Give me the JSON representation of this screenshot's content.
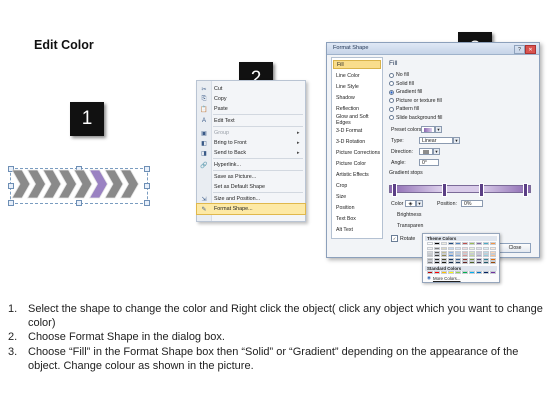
{
  "page": {
    "title": "Edit Color"
  },
  "steps": [
    "1",
    "2",
    "3"
  ],
  "context_menu": {
    "items": [
      {
        "label": "Cut",
        "icon": "scissors-icon",
        "glyph": "✂",
        "state": "normal",
        "submenu": false
      },
      {
        "label": "Copy",
        "icon": "copy-icon",
        "glyph": "⎘",
        "state": "normal",
        "submenu": false
      },
      {
        "label": "Paste",
        "icon": "paste-icon",
        "glyph": "📋",
        "state": "normal",
        "submenu": false
      },
      {
        "label": "Edit Text",
        "icon": "text-icon",
        "glyph": "A",
        "state": "normal",
        "submenu": false
      },
      {
        "label": "Group",
        "icon": "group-icon",
        "glyph": "▣",
        "state": "disabled",
        "submenu": true
      },
      {
        "label": "Bring to Front",
        "icon": "bring-front-icon",
        "glyph": "◧",
        "state": "normal",
        "submenu": true
      },
      {
        "label": "Send to Back",
        "icon": "send-back-icon",
        "glyph": "◨",
        "state": "normal",
        "submenu": true
      },
      {
        "label": "Hyperlink...",
        "icon": "hyperlink-icon",
        "glyph": "🔗",
        "state": "normal",
        "submenu": false
      },
      {
        "label": "Save as Picture...",
        "icon": "",
        "glyph": "",
        "state": "normal",
        "submenu": false
      },
      {
        "label": "Set as Default Shape",
        "icon": "",
        "glyph": "",
        "state": "normal",
        "submenu": false
      },
      {
        "label": "Size and Position...",
        "icon": "size-icon",
        "glyph": "⇲",
        "state": "normal",
        "submenu": false
      },
      {
        "label": "Format Shape...",
        "icon": "format-shape-icon",
        "glyph": "✎",
        "state": "highlight",
        "submenu": false
      }
    ]
  },
  "format_dialog": {
    "title": "Format Shape",
    "help_glyph": "?",
    "close_glyph": "✕",
    "categories": [
      "Fill",
      "Line Color",
      "Line Style",
      "Shadow",
      "Reflection",
      "Glow and Soft Edges",
      "3-D Format",
      "3-D Rotation",
      "Picture Corrections",
      "Picture Color",
      "Artistic Effects",
      "Crop",
      "Size",
      "Position",
      "Text Box",
      "Alt Text"
    ],
    "selected_category": "Fill",
    "fill_heading": "Fill",
    "fill_options": [
      "No fill",
      "Solid fill",
      "Gradient fill",
      "Picture or texture fill",
      "Pattern fill",
      "Slide background fill"
    ],
    "selected_fill": "Gradient fill",
    "fields": {
      "preset_label": "Preset colors:",
      "type_label": "Type:",
      "type_value": "Linear",
      "direction_label": "Direction:",
      "angle_label": "Angle:",
      "angle_value": "0°",
      "gradient_stops_label": "Gradient stops",
      "color_label": "Color",
      "position_label": "Position:",
      "position_value": "0%",
      "brightness_label": "Brightness",
      "transparency_label": "Transparen",
      "rotate_label": "Rotate"
    },
    "close_label": "Close"
  },
  "palette": {
    "theme_title": "Theme Colors",
    "standard_title": "Standard Colors",
    "more_label": "More Colors...",
    "theme_top_row": [
      "#ffffff",
      "#000000",
      "#eeece1",
      "#1f497d",
      "#4f81bd",
      "#c0504d",
      "#9bbb59",
      "#8064a2",
      "#4bacc6",
      "#f79646"
    ],
    "theme_shades": [
      [
        "#f2f2f2",
        "#7f7f7f",
        "#ddd9c3",
        "#c6d9f0",
        "#dbe5f1",
        "#f2dcdb",
        "#ebf1dd",
        "#e5e0ec",
        "#dbeef3",
        "#fdeada"
      ],
      [
        "#d8d8d8",
        "#595959",
        "#c4bd97",
        "#8db3e2",
        "#b8cce4",
        "#e5b9b7",
        "#d7e3bc",
        "#ccc1d9",
        "#b7dde8",
        "#fbd5b5"
      ],
      [
        "#bfbfbf",
        "#3f3f3f",
        "#938953",
        "#548dd4",
        "#95b3d7",
        "#d99694",
        "#c3d69b",
        "#b2a2c7",
        "#92cddc",
        "#fac08f"
      ],
      [
        "#a5a5a5",
        "#262626",
        "#494429",
        "#17365d",
        "#366092",
        "#953734",
        "#76923c",
        "#5f497a",
        "#31859b",
        "#e36c09"
      ],
      [
        "#7f7f7f",
        "#0c0c0c",
        "#1d1b10",
        "#0f243e",
        "#244061",
        "#632423",
        "#4f6128",
        "#3f3151",
        "#205867",
        "#974806"
      ]
    ],
    "standard_colors": [
      "#c00000",
      "#ff0000",
      "#ffc000",
      "#ffff00",
      "#92d050",
      "#00b050",
      "#00b0f0",
      "#0070c0",
      "#002060",
      "#7030a0"
    ]
  },
  "shapes": {
    "fills": [
      "#8a8a8a",
      "#8a8a8a",
      "#8a8a8a",
      "#8a8a8a",
      "#8a8a8a",
      "#9a82c2",
      "#8a8a8a",
      "#8a8a8a"
    ]
  },
  "instructions": [
    {
      "num": "1.",
      "text": "Select the shape to change the color and Right click the object( click any object which you want to change color)"
    },
    {
      "num": "2.",
      "text": "Choose Format Shape in the dialog box."
    },
    {
      "num": "3.",
      "text": "Choose “Fill” in the Format Shape box then “Solid” or “Gradient” depending on the appearance of the object. Change colour as shown in the picture."
    }
  ]
}
